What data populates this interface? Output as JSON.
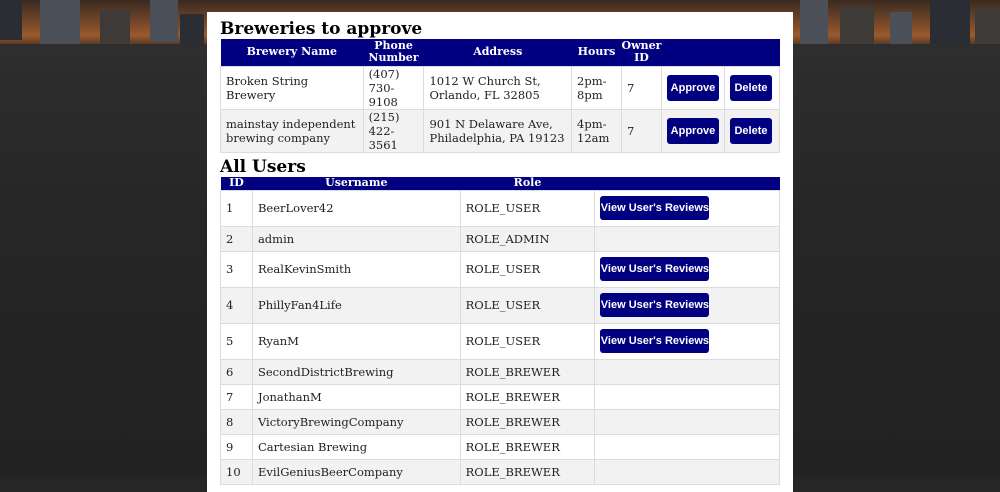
{
  "breweries_section": {
    "title": "Breweries to approve",
    "headers": {
      "name": "Brewery Name",
      "phone": "Phone Number",
      "address": "Address",
      "hours": "Hours",
      "owner": "Owner ID"
    },
    "rows": [
      {
        "name": "Broken String Brewery",
        "phone": "(407) 730-9108",
        "address": "1012 W Church St, Orlando, FL 32805",
        "hours": "2pm-8pm",
        "owner": "7",
        "approve": "Approve",
        "delete": "Delete"
      },
      {
        "name": "mainstay independent brewing company",
        "phone": "(215) 422-3561",
        "address": "901 N Delaware Ave, Philadelphia, PA 19123",
        "hours": "4pm-12am",
        "owner": "7",
        "approve": "Approve",
        "delete": "Delete"
      }
    ]
  },
  "users_section": {
    "title": "All Users",
    "headers": {
      "id": "ID",
      "username": "Username",
      "role": "Role"
    },
    "view_reviews_label": "View User's Reviews",
    "rows": [
      {
        "id": "1",
        "username": "BeerLover42",
        "role": "ROLE_USER",
        "has_reviews": true
      },
      {
        "id": "2",
        "username": "admin",
        "role": "ROLE_ADMIN",
        "has_reviews": false
      },
      {
        "id": "3",
        "username": "RealKevinSmith",
        "role": "ROLE_USER",
        "has_reviews": true
      },
      {
        "id": "4",
        "username": "PhillyFan4Life",
        "role": "ROLE_USER",
        "has_reviews": true
      },
      {
        "id": "5",
        "username": "RyanM",
        "role": "ROLE_USER",
        "has_reviews": true
      },
      {
        "id": "6",
        "username": "SecondDistrictBrewing",
        "role": "ROLE_BREWER",
        "has_reviews": false
      },
      {
        "id": "7",
        "username": "JonathanM",
        "role": "ROLE_BREWER",
        "has_reviews": false
      },
      {
        "id": "8",
        "username": "VictoryBrewingCompany",
        "role": "ROLE_BREWER",
        "has_reviews": false
      },
      {
        "id": "9",
        "username": "Cartesian Brewing",
        "role": "ROLE_BREWER",
        "has_reviews": false
      },
      {
        "id": "10",
        "username": "EvilGeniusBeerCompany",
        "role": "ROLE_BREWER",
        "has_reviews": false
      }
    ]
  },
  "colors": {
    "header_bg": "#000080",
    "button_bg": "#000080",
    "page_bg": "#262626"
  }
}
